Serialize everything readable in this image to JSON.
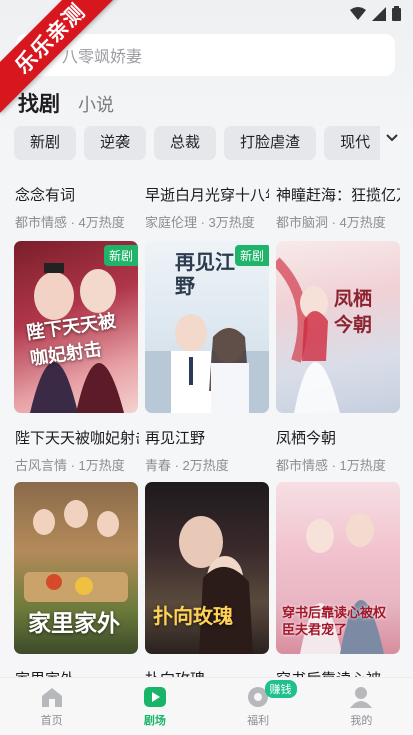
{
  "ribbon": {
    "text": "乐乐亲测"
  },
  "search": {
    "placeholder": "八零飒娇妻"
  },
  "main_tabs": [
    {
      "label": "找剧"
    },
    {
      "label": "小说"
    }
  ],
  "chips": [
    "新剧",
    "逆袭",
    "总裁",
    "打脸虐渣",
    "现代"
  ],
  "row1": [
    {
      "title": "念念有词",
      "meta": "都市情感 · 4万热度"
    },
    {
      "title": "早逝白月光穿十八年后",
      "meta": "家庭伦理 · 3万热度"
    },
    {
      "title": "神瞳赶海：狂揽亿万",
      "meta": "都市脑洞 · 4万热度"
    }
  ],
  "row2": [
    {
      "title": "陛下天天被咖妃射击",
      "meta": "古风言情 · 1万热度",
      "badge": "新剧",
      "cover_text": "陛下天天被咖妃射击"
    },
    {
      "title": "再见江野",
      "meta": "青春 · 2万热度",
      "badge": "新剧",
      "cover_text": "再见江野"
    },
    {
      "title": "凤栖今朝",
      "meta": "都市情感 · 1万热度",
      "badge": "",
      "cover_text": "凤栖今朝"
    }
  ],
  "row3": [
    {
      "title": "家里家外",
      "cover_text": "家里家外"
    },
    {
      "title": "扑向玫瑰",
      "cover_text": "扑向玫瑰"
    },
    {
      "title": "穿书后靠读心被",
      "cover_text": "穿书后靠读心被权臣夫君宠了"
    }
  ],
  "bottom_nav": [
    {
      "label": "首页",
      "icon": "home-icon"
    },
    {
      "label": "剧场",
      "icon": "theater-icon",
      "active": true
    },
    {
      "label": "福利",
      "icon": "welfare-icon",
      "badge": "赚钱"
    },
    {
      "label": "我的",
      "icon": "profile-icon"
    }
  ],
  "colors": {
    "accent": "#18b468",
    "badge": "#20b46a",
    "ribbon": "#d7161d"
  }
}
